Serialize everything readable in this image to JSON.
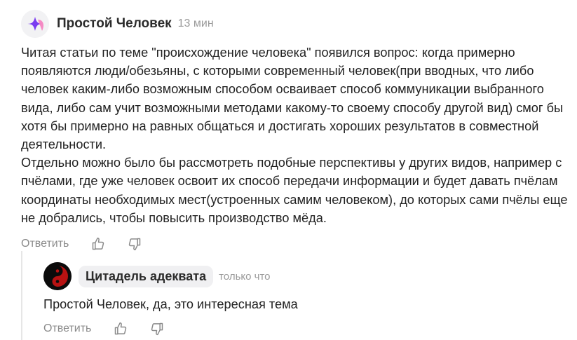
{
  "comment": {
    "author": "Простой Человек",
    "time": "13 мин",
    "paragraphs": [
      "Читая статьи по теме \"происхождение человека\" появился вопрос: когда примерно появляются люди/обезьяны, с которыми современный человек(при вводных, что либо человек каким-либо возможным способом осваивает способ коммуникации выбранного вида, либо сам учит возможными методами какому-то своему способу другой вид) смог бы хотя бы примерно на равных общаться и достигать хороших результатов в совместной деятельности.",
      "Отдельно можно было бы рассмотреть подобные перспективы у других видов, например с пчёлами, где уже человек освоит их способ передачи информации и будет давать пчёлам координаты необходимых мест(устроенных самим человеком), до которых сами пчёлы еще не добрались, чтобы повысить производство мёда."
    ],
    "reply_label": "Ответить"
  },
  "reply": {
    "author": "Цитадель адеквата",
    "time": "только что",
    "text": "Простой Человек, да, это интересная тема",
    "reply_label": "Ответить"
  },
  "icons": [
    "like-icon",
    "dislike-icon"
  ],
  "colors": {
    "text": "#222222",
    "muted": "#8a8a8a",
    "pill_bg": "#f0f0f2",
    "thread_line": "#e6e6e6"
  }
}
